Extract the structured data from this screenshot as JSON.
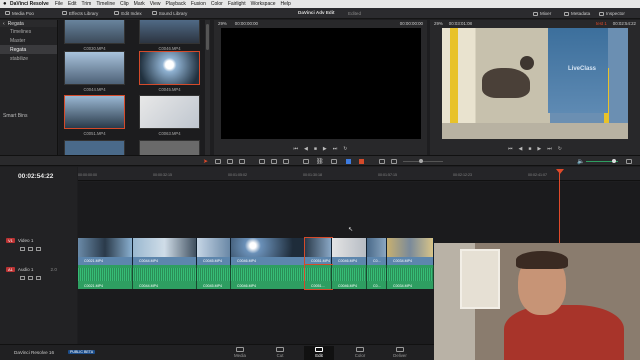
{
  "menubar": {
    "app": "DaVinci Resolve",
    "items": [
      "File",
      "Edit",
      "Trim",
      "Timeline",
      "Clip",
      "Mark",
      "View",
      "Playback",
      "Fusion",
      "Color",
      "Fairlight",
      "Workspace",
      "Help"
    ]
  },
  "toolbar": {
    "media_pool": "Media Poo",
    "effects_library": "Effects Library",
    "edit_index": "Edit Index",
    "sound_library": "Sound Library",
    "project_title": "DaVinci Adv Edit",
    "edited": "Edited",
    "mixer": "Mixer",
    "metadata": "Metadata",
    "inspector": "Inspector"
  },
  "bins": {
    "header": "Regata",
    "items": [
      "Timelines",
      "Master",
      "Regata",
      "stabilize"
    ],
    "selected_index": 2,
    "smart_bins": "Smart Bins"
  },
  "pool": {
    "labels": [
      "C0030.MP4",
      "C0044.MP4",
      "C0045.MP4",
      "C0046.MP4",
      "C0051.MP4",
      "C0063.MP4"
    ]
  },
  "source_viewer": {
    "zoom": "29%",
    "timecode_left": "00:00:00:00",
    "timecode_right": "00:00:00:00"
  },
  "record_viewer": {
    "zoom": "29%",
    "timecode": "00:03:01:08",
    "timeline_name": "test 1",
    "timecode_right": "00:02:54:22",
    "watermark": "LiveClass"
  },
  "timeline": {
    "timecode": "00:02:54:22",
    "ruler": [
      "00:00:00:00",
      "00:00:32:15",
      "00:01:05:02",
      "00:01:30:18",
      "00:01:57:15",
      "00:02:12:23",
      "00:02:41:07"
    ],
    "video_track": {
      "id": "V1",
      "name": "Video 1"
    },
    "audio_track": {
      "id": "A1",
      "name": "Audio 1",
      "channels": "2.0"
    },
    "video_clips": [
      "C0021.MP4",
      "C0044.MP4",
      "C0045.MP4",
      "C0046.MP4",
      "C0051.MP4",
      "C0046.MP4",
      "C0...",
      "C0034.MP4"
    ],
    "audio_clips": [
      "C0021.MP4",
      "C0044.MP4",
      "C0045.MP4",
      "C0046.MP4",
      "C0051...",
      "C0046.MP4",
      "C0...",
      "C0034.MP4"
    ]
  },
  "pages": {
    "brand": "DaVinci Resolve 16",
    "beta": "PUBLIC BETA",
    "tabs": [
      "Media",
      "Cut",
      "Edit",
      "Color",
      "Deliver"
    ],
    "active": "Edit"
  },
  "colors": {
    "accent": "#d44a2a",
    "video_clip": "#5d86ad",
    "audio_clip": "#2e9e61"
  }
}
